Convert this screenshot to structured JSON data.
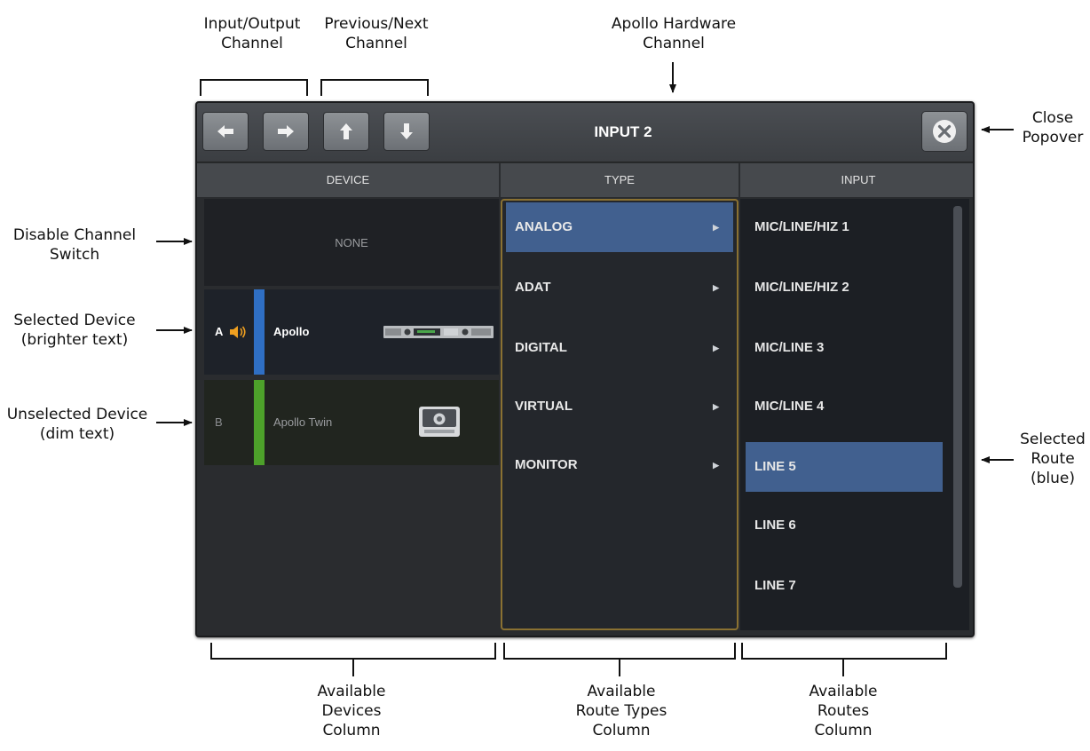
{
  "window": {
    "title": "INPUT 2"
  },
  "toolbar": {
    "buttons": [
      {
        "icon": "arrow-left-icon"
      },
      {
        "icon": "arrow-right-icon"
      },
      {
        "icon": "arrow-up-icon"
      },
      {
        "icon": "arrow-down-icon"
      }
    ],
    "close_icon": "close-circle-icon"
  },
  "columns": {
    "device": "DEVICE",
    "type": "TYPE",
    "input": "INPUT"
  },
  "devices": {
    "none_label": "NONE",
    "items": [
      {
        "letter": "A",
        "name": "Apollo",
        "stripe_color": "#2f6fc4",
        "selected": true
      },
      {
        "letter": "B",
        "name": "Apollo Twin",
        "stripe_color": "#4da12a",
        "selected": false
      }
    ]
  },
  "types": [
    {
      "label": "ANALOG",
      "selected": true
    },
    {
      "label": "ADAT",
      "selected": false
    },
    {
      "label": "DIGITAL",
      "selected": false
    },
    {
      "label": "VIRTUAL",
      "selected": false
    },
    {
      "label": "MONITOR",
      "selected": false
    }
  ],
  "inputs": [
    {
      "label": "MIC/LINE/HIZ 1",
      "selected": false
    },
    {
      "label": "MIC/LINE/HIZ 2",
      "selected": false
    },
    {
      "label": "MIC/LINE 3",
      "selected": false
    },
    {
      "label": "MIC/LINE 4",
      "selected": false
    },
    {
      "label": "LINE 5",
      "selected": true
    },
    {
      "label": "LINE 6",
      "selected": false
    },
    {
      "label": "LINE 7",
      "selected": false
    }
  ],
  "callouts": {
    "input_output": "Input/Output\nChannel",
    "prev_next": "Previous/Next\nChannel",
    "hardware": "Apollo Hardware\nChannel",
    "close": "Close\nPopover",
    "disable": "Disable Channel\nSwitch",
    "selected_device": "Selected Device\n(brighter text)",
    "unselected_device": "Unselected Device\n(dim text)",
    "selected_route": "Selected\nRoute\n(blue)",
    "devices_column": "Available\nDevices\nColumn",
    "route_types_column": "Available\nRoute Types\nColumn",
    "routes_column": "Available\nRoutes\nColumn"
  },
  "colors": {
    "selection_blue": "#41608f",
    "type_column_border": "#8a7132",
    "speaker_orange": "#f0a020"
  }
}
